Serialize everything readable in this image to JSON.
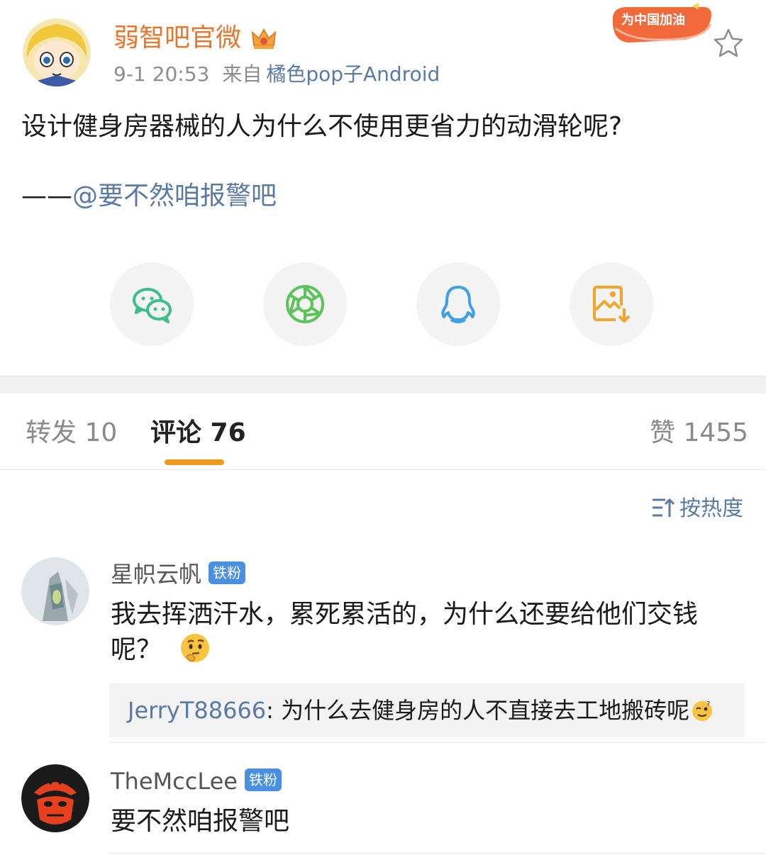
{
  "post": {
    "author": "弱智吧官微",
    "time": "9-1 20:53",
    "from_label": "来自",
    "source": "橘色pop子Android",
    "badge_text": "为中国加油",
    "text": "设计健身房器械的人为什么不使用更省力的动滑轮呢?",
    "quote_dash": "——",
    "quote_mention": "@要不然咱报警吧"
  },
  "share": {
    "items": [
      {
        "icon": "wechat-icon",
        "color": "#3cc08a"
      },
      {
        "icon": "moments-icon",
        "color": "#5ac45a"
      },
      {
        "icon": "qq-icon",
        "color": "#3f9fe8"
      },
      {
        "icon": "save-image-icon",
        "color": "#f2a52a"
      }
    ]
  },
  "tabs": {
    "repost": "转发 10",
    "comments": "评论 76",
    "likes": "赞 1455"
  },
  "sort": {
    "label": "按热度"
  },
  "comments": [
    {
      "name": "星帜云帆",
      "badge": "铁粉",
      "text_line1": "我去挥洒汗水，累死累活的，为什么还要给他们交钱",
      "text_line2": "呢？",
      "reply": {
        "name": "JerryT88666",
        "text": ": 为什么去健身房的人不直接去工地搬砖呢"
      }
    },
    {
      "name": "TheMccLee",
      "badge": "铁粉",
      "text_line1": "要不然咱报警吧"
    }
  ],
  "colors": {
    "accent_orange": "#f29a1f",
    "link_blue": "#5a7aa6",
    "author_orange": "#e8762c"
  }
}
